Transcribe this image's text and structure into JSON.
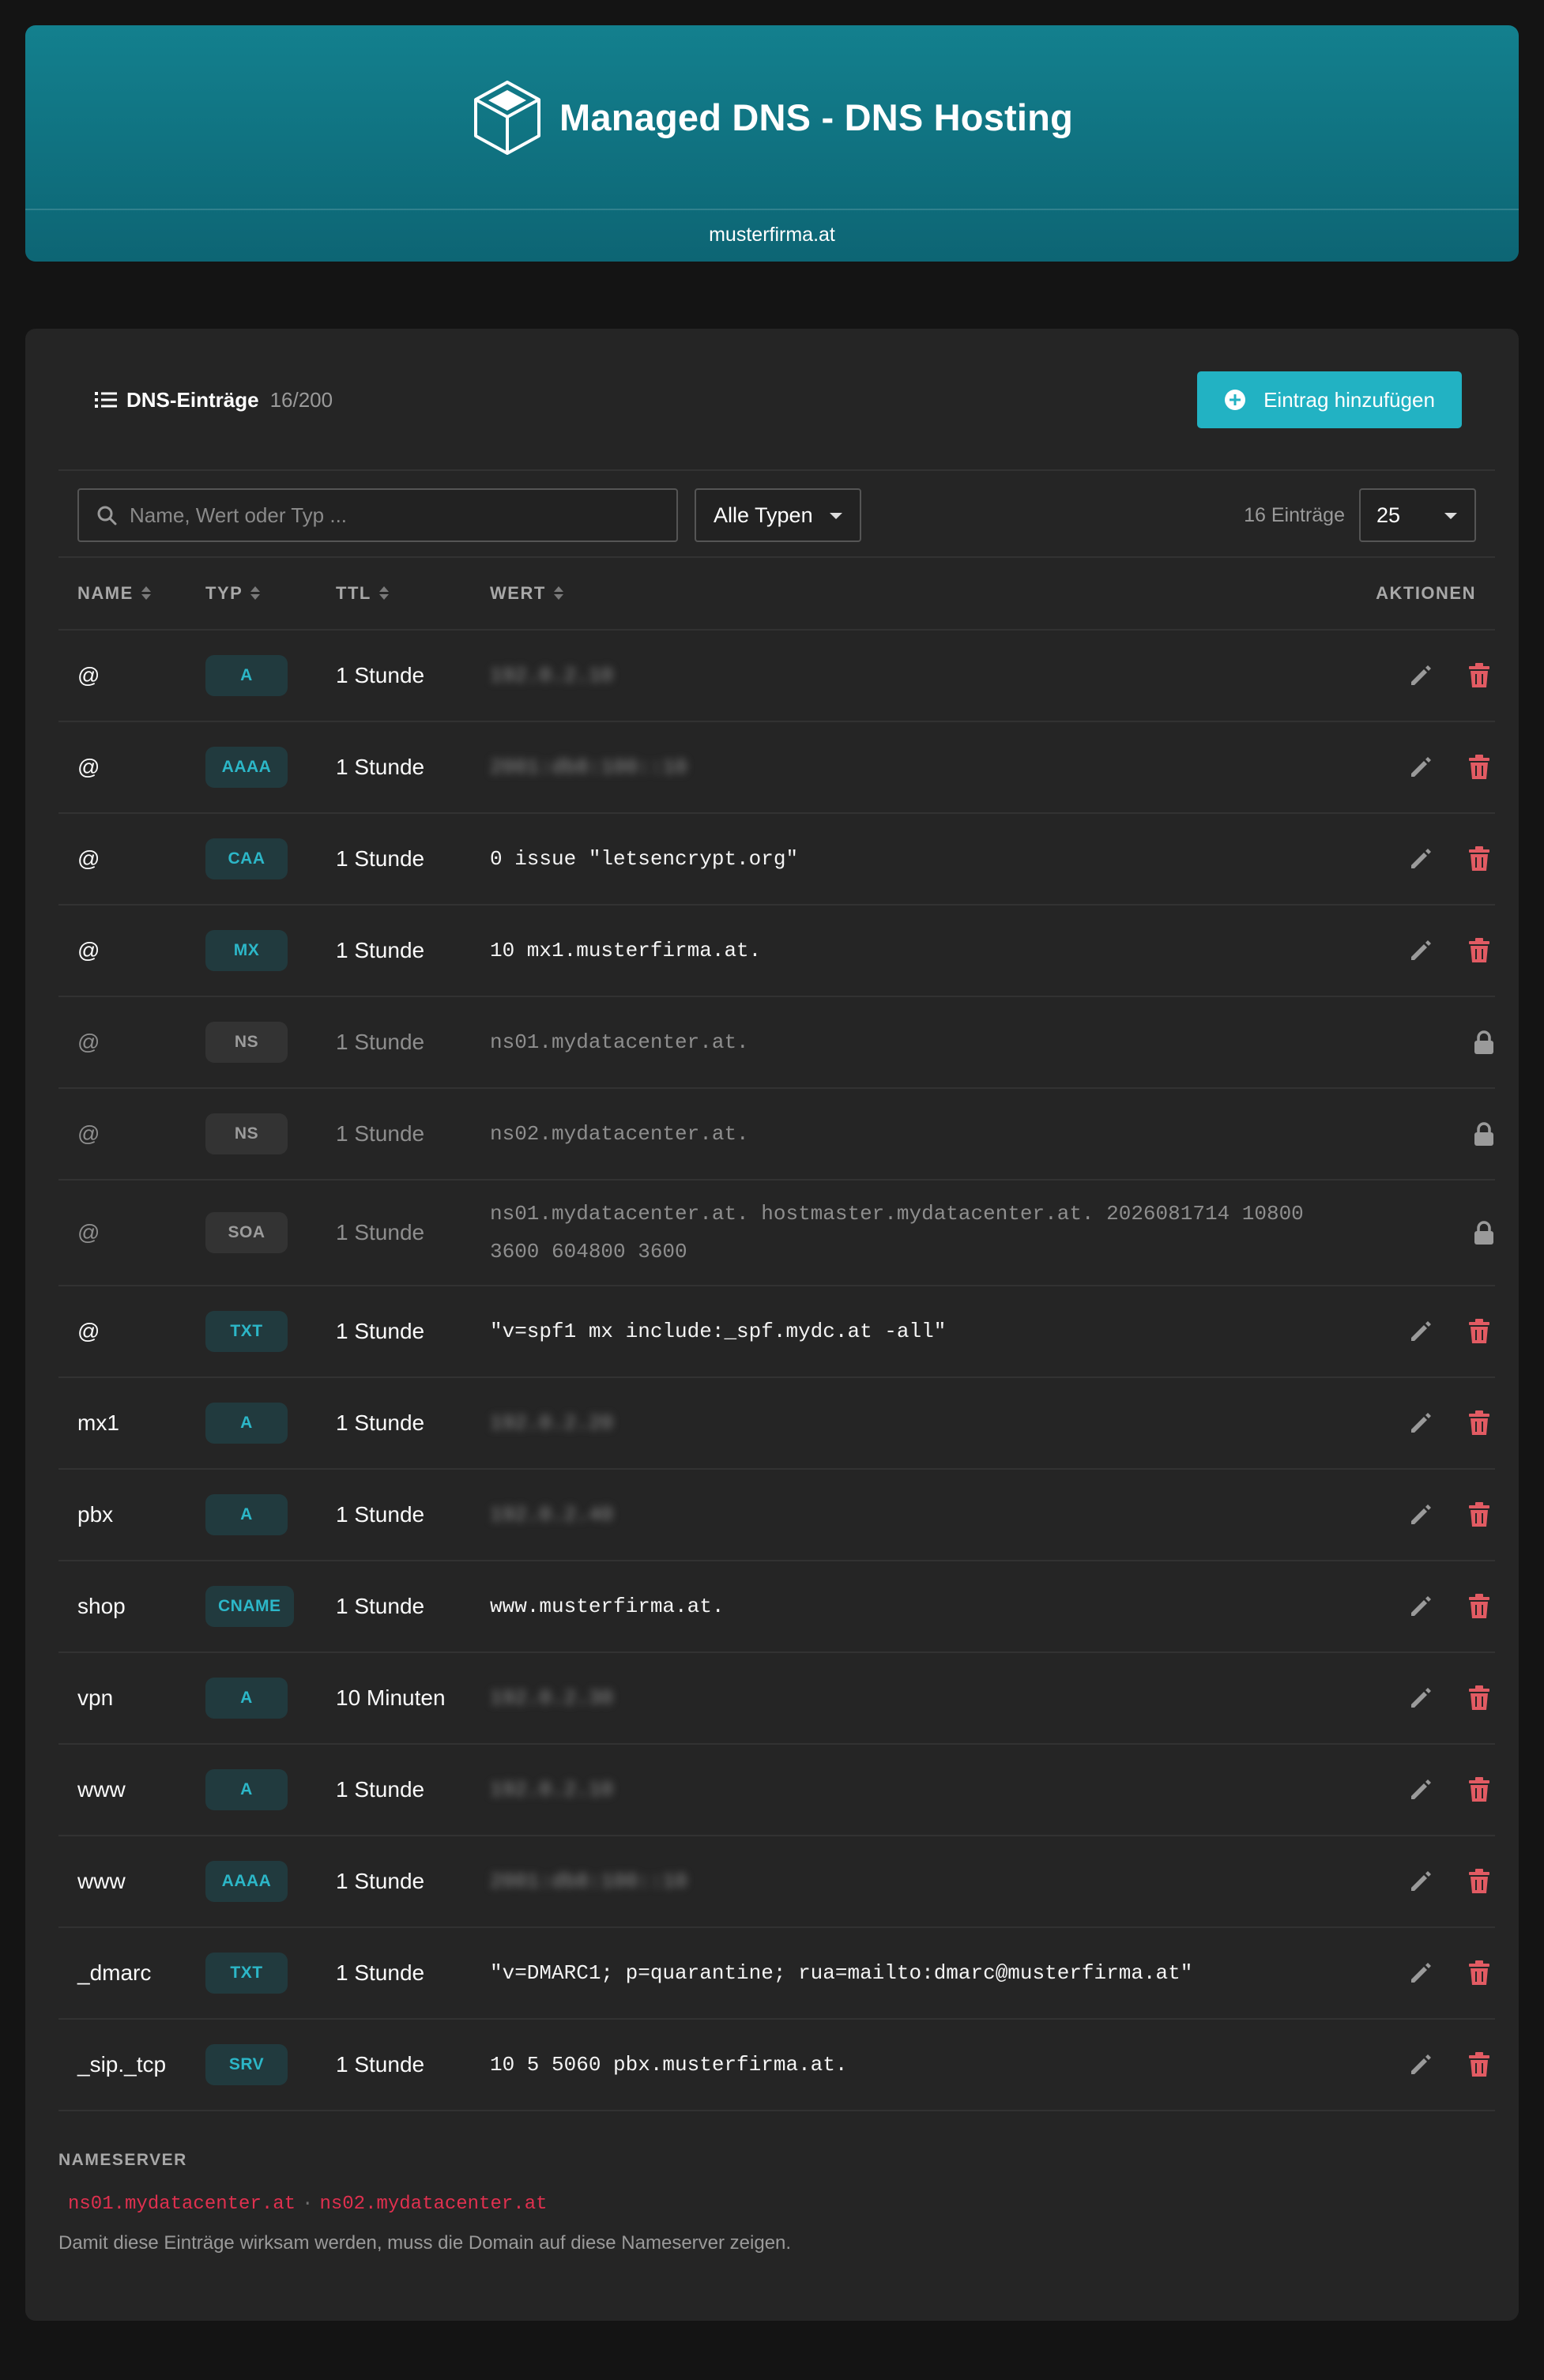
{
  "header": {
    "title": "Managed DNS - DNS Hosting",
    "domain": "musterfirma.at",
    "brand_color": "#13808e"
  },
  "panel": {
    "title": "DNS-Einträge",
    "count": "16/200",
    "add_button_label": "Eintrag hinzufügen",
    "accent_color": "#22b2c3"
  },
  "toolbar": {
    "search_placeholder": "Name, Wert oder Typ ...",
    "type_filter_value": "Alle Typen",
    "entries_label": "16 Einträge",
    "per_page_value": "25"
  },
  "table": {
    "headers": {
      "name": "NAME",
      "type": "TYP",
      "ttl": "TTL",
      "value": "WERT",
      "actions": "AKTIONEN"
    },
    "rows": [
      {
        "name": "@",
        "type": "A",
        "ttl": "1 Stunde",
        "value": "192.0.2.10",
        "blurred": true,
        "locked": false
      },
      {
        "name": "@",
        "type": "AAAA",
        "ttl": "1 Stunde",
        "value": "2001:db8:100::10",
        "blurred": true,
        "locked": false
      },
      {
        "name": "@",
        "type": "CAA",
        "ttl": "1 Stunde",
        "value": "0 issue \"letsencrypt.org\"",
        "blurred": false,
        "locked": false
      },
      {
        "name": "@",
        "type": "MX",
        "ttl": "1 Stunde",
        "value": "10 mx1.musterfirma.at.",
        "blurred": false,
        "locked": false
      },
      {
        "name": "@",
        "type": "NS",
        "ttl": "1 Stunde",
        "value": "ns01.mydatacenter.at.",
        "blurred": false,
        "locked": true
      },
      {
        "name": "@",
        "type": "NS",
        "ttl": "1 Stunde",
        "value": "ns02.mydatacenter.at.",
        "blurred": false,
        "locked": true
      },
      {
        "name": "@",
        "type": "SOA",
        "ttl": "1 Stunde",
        "value": "ns01.mydatacenter.at. hostmaster.mydatacenter.at. 2026081714 10800 3600 604800 3600",
        "blurred": false,
        "locked": true
      },
      {
        "name": "@",
        "type": "TXT",
        "ttl": "1 Stunde",
        "value": "\"v=spf1 mx include:_spf.mydc.at -all\"",
        "blurred": false,
        "locked": false
      },
      {
        "name": "mx1",
        "type": "A",
        "ttl": "1 Stunde",
        "value": "192.0.2.20",
        "blurred": true,
        "locked": false
      },
      {
        "name": "pbx",
        "type": "A",
        "ttl": "1 Stunde",
        "value": "192.0.2.40",
        "blurred": true,
        "locked": false
      },
      {
        "name": "shop",
        "type": "CNAME",
        "ttl": "1 Stunde",
        "value": "www.musterfirma.at.",
        "blurred": false,
        "locked": false
      },
      {
        "name": "vpn",
        "type": "A",
        "ttl": "10 Minuten",
        "value": "192.0.2.30",
        "blurred": true,
        "locked": false
      },
      {
        "name": "www",
        "type": "A",
        "ttl": "1 Stunde",
        "value": "192.0.2.10",
        "blurred": true,
        "locked": false
      },
      {
        "name": "www",
        "type": "AAAA",
        "ttl": "1 Stunde",
        "value": "2001:db8:100::10",
        "blurred": true,
        "locked": false
      },
      {
        "name": "_dmarc",
        "type": "TXT",
        "ttl": "1 Stunde",
        "value": "\"v=DMARC1; p=quarantine; rua=mailto:dmarc@musterfirma.at\"",
        "blurred": false,
        "locked": false
      },
      {
        "name": "_sip._tcp",
        "type": "SRV",
        "ttl": "1 Stunde",
        "value": "10 5 5060 pbx.musterfirma.at.",
        "blurred": false,
        "locked": false
      }
    ]
  },
  "nameserver": {
    "title": "NAMESERVER",
    "servers": [
      "ns01.mydatacenter.at",
      "ns02.mydatacenter.at"
    ],
    "separator": "·",
    "note": "Damit diese Einträge wirksam werden, muss die Domain auf diese Nameserver zeigen.",
    "server_color": "#e0304f"
  },
  "icons": {
    "edit": "pencil-icon",
    "delete": "trash-icon",
    "locked": "lock-icon",
    "delete_color": "#e25b63"
  }
}
